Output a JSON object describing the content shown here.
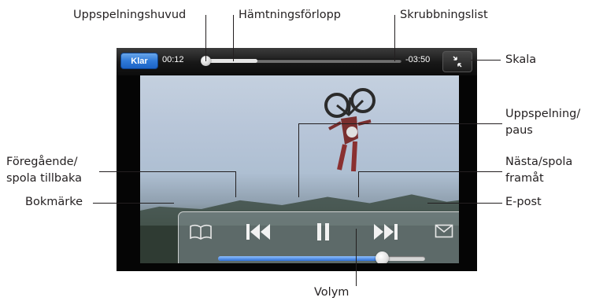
{
  "player": {
    "done_label": "Klar",
    "elapsed": "00:12",
    "remaining": "-03:50",
    "playhead_fraction": 0.02,
    "download_fraction": 0.28,
    "volume_fraction": 0.79
  },
  "callouts": {
    "playhead": "Uppspelningshuvud",
    "download_progress": "Hämtningsförlopp",
    "scrubber_bar": "Skrubbningslist",
    "scale": "Skala",
    "play_pause": [
      "Uppspelning/",
      "paus"
    ],
    "previous_rewind": [
      "Föregående/",
      "spola tillbaka"
    ],
    "next_forward": [
      "Nästa/spola",
      "framåt"
    ],
    "bookmark": "Bokmärke",
    "email": "E-post",
    "volume": "Volym"
  },
  "icons": {
    "bookmark": "book-icon",
    "previous": "skip-back-icon",
    "play_pause": "pause-icon",
    "next": "skip-forward-icon",
    "email": "envelope-icon",
    "scale": "shrink-arrows-icon"
  },
  "colors": {
    "done_button": "#2f7ad9",
    "volume_fill": "#2f6fd3",
    "callout_text": "#231f20"
  }
}
